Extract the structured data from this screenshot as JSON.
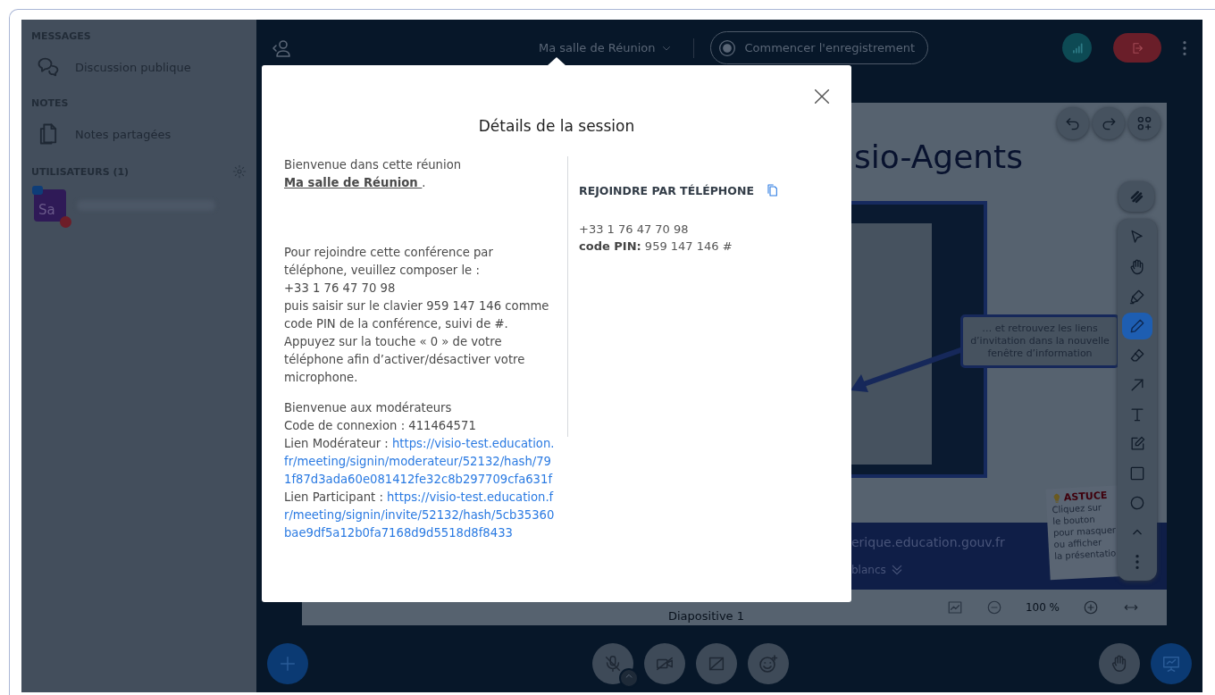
{
  "sidebar": {
    "sections": [
      {
        "title": "MESSAGES",
        "items": [
          {
            "kind": "chat",
            "label": "Discussion publique"
          }
        ]
      },
      {
        "title": "NOTES",
        "items": [
          {
            "kind": "notes",
            "label": "Notes partagées"
          }
        ]
      }
    ],
    "users": {
      "title": "UTILISATEURS (1)",
      "list": [
        {
          "initials": "Sa"
        }
      ]
    }
  },
  "topbar": {
    "meeting_title": "Ma salle de Réunion",
    "record_button": "Commencer l'enregistrement"
  },
  "slide": {
    "title": "sio-Agents",
    "callout": "… et retrouvez les liens d’invitation dans la nouvelle fenêtre d’information",
    "tip_title": "ASTUCE",
    "tip_lines": [
      "Cliquez sur",
      "le bouton",
      "pour masquer",
      "ou afficher",
      "la présentatio"
    ],
    "band_url": "erique.education.gouv.fr",
    "band_link": "blancs",
    "tools": [
      {
        "kind": "select",
        "selected": false
      },
      {
        "kind": "hand",
        "selected": false
      },
      {
        "kind": "highlighter",
        "selected": false
      },
      {
        "kind": "pencil",
        "selected": true
      },
      {
        "kind": "eraser",
        "selected": false
      },
      {
        "kind": "arrow",
        "selected": false
      },
      {
        "kind": "text",
        "selected": false
      },
      {
        "kind": "note",
        "selected": false
      },
      {
        "kind": "rectangle",
        "selected": false
      },
      {
        "kind": "ellipse",
        "selected": false
      },
      {
        "kind": "collapse",
        "selected": false
      },
      {
        "kind": "more",
        "selected": false
      }
    ],
    "footer": {
      "slide_label": "Diapositive 1",
      "zoom": "100 %"
    }
  },
  "modal": {
    "title": "Détails de la session",
    "welcome": {
      "text": "Bienvenue dans cette réunion ",
      "room": "Ma salle de Réunion ",
      "after": "."
    },
    "dial_in": [
      "Pour rejoindre cette conférence par téléphone, veuillez composer le :",
      "+33 1 76 47 70 98",
      "puis saisir sur le clavier 959 147 146 comme code PIN de la conférence, suivi de #.",
      "Appuyez sur la touche « 0 » de votre téléphone afin d’activer/désactiver votre microphone."
    ],
    "moderators": {
      "heading": "Bienvenue aux modérateurs",
      "code": "Code de connexion : 411464571",
      "links": [
        {
          "label": "Lien Modérateur  : ",
          "url": "https://visio-test.education.fr/meeting/signin/moderateur/52132/hash/791f87d3ada60e081412fe32c8b297709cfa631f"
        },
        {
          "label": "Lien Participant  : ",
          "url": "https://visio-test.education.fr/meeting/signin/invite/52132/hash/5cb35360bae9df5a12b0fa7168d9d5518d8f8433"
        }
      ]
    },
    "phone": {
      "heading": "REJOINDRE PAR TÉLÉPHONE",
      "number": "+33 1 76 47 70 98",
      "pin": "**code PIN:** 959 147 146 #"
    }
  }
}
